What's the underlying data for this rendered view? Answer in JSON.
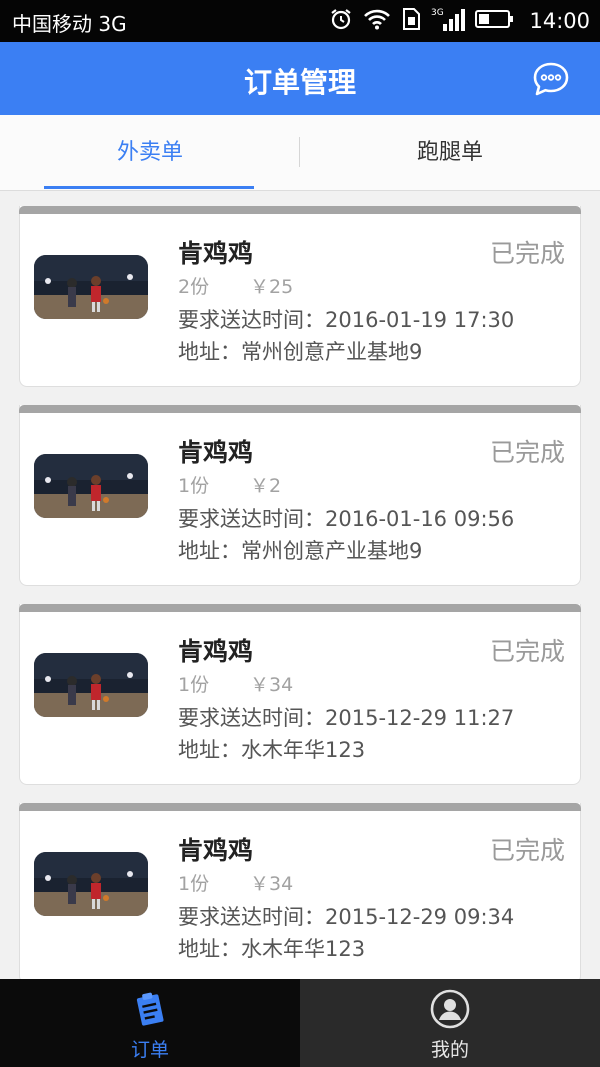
{
  "status_bar": {
    "carrier": "中国移动 3G",
    "network": "3G",
    "time": "14:00"
  },
  "header": {
    "title": "订单管理",
    "chat_icon": "chat-bubble-icon"
  },
  "tabs": [
    {
      "label": "外卖单",
      "active": true
    },
    {
      "label": "跑腿单",
      "active": false
    }
  ],
  "orders": [
    {
      "shop": "肯鸡鸡",
      "status": "已完成",
      "qty": "2份",
      "price": "￥25",
      "deliver_time": "要求送达时间：2016-01-19 17:30",
      "address": "地址：常州创意产业基地9"
    },
    {
      "shop": "肯鸡鸡",
      "status": "已完成",
      "qty": "1份",
      "price": "￥2",
      "deliver_time": "要求送达时间：2016-01-16 09:56",
      "address": "地址：常州创意产业基地9"
    },
    {
      "shop": "肯鸡鸡",
      "status": "已完成",
      "qty": "1份",
      "price": "￥34",
      "deliver_time": "要求送达时间：2015-12-29 11:27",
      "address": "地址：水木年华123"
    },
    {
      "shop": "肯鸡鸡",
      "status": "已完成",
      "qty": "1份",
      "price": "￥34",
      "deliver_time": "要求送达时间：2015-12-29 09:34",
      "address": "地址：水木年华123"
    }
  ],
  "bottom_nav": [
    {
      "label": "订单",
      "icon": "order-clipboard-icon",
      "active": true
    },
    {
      "label": "我的",
      "icon": "user-avatar-icon",
      "active": false
    }
  ],
  "colors": {
    "accent": "#3b7ff3",
    "status_bar": "#050505",
    "bottom_nav": "#111111",
    "status_text": "#9a9a9a"
  }
}
